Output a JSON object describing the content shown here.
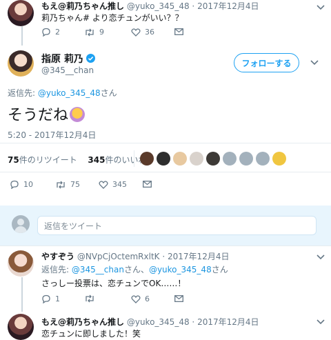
{
  "tweet_top": {
    "display_name": "もえ@莉乃ちゃん推し",
    "handle": "@yuko_345_48",
    "sep": "·",
    "date": "2017年12月4日",
    "text": "莉乃ちゃん# より恋チュンがいい？？",
    "replies": "2",
    "retweets": "9",
    "likes": "36"
  },
  "main_tweet": {
    "display_name": "指原 莉乃",
    "handle": "@345__chan",
    "follow_label": "フォローする",
    "reply_to_prefix": "返信先: ",
    "reply_to_handle": "@yuko_345_48",
    "reply_to_suffix": "さん",
    "text": "そうだね",
    "timestamp": "5:20 - 2017年12月4日",
    "retweet_count": "75",
    "retweet_label": "件のリツイート",
    "like_count": "345",
    "like_label": "件のいいね",
    "replies": "10",
    "retweets": "75",
    "likes": "345"
  },
  "reply_box": {
    "placeholder": "返信をツイート"
  },
  "reply_1": {
    "display_name": "やすぞう",
    "handle": "@NVpCjOctemRxltK",
    "sep": "·",
    "date": "2017年12月4日",
    "reply_to_prefix": "返信先: ",
    "reply_to_handle_1": "@345__chan",
    "reply_to_mid": "さん、",
    "reply_to_handle_2": "@yuko_345_48",
    "reply_to_suffix": "さん",
    "text": "さっしー投票は、恋チュンでOK……！",
    "replies": "1",
    "retweets": "",
    "likes": "6"
  },
  "reply_2": {
    "display_name": "もえ@莉乃ちゃん推し",
    "handle": "@yuko_345_48",
    "sep": "·",
    "date": "2017年12月4日",
    "text": "恋チュンに即しました！笑"
  },
  "colors": {
    "accent": "#1da1f2",
    "link": "#1b95e0",
    "muted": "#657786",
    "verified": "#1da1f2"
  },
  "icons": [
    "reply-icon",
    "retweet-icon",
    "like-icon",
    "dm-icon",
    "chevron-down-icon",
    "verified-icon"
  ]
}
